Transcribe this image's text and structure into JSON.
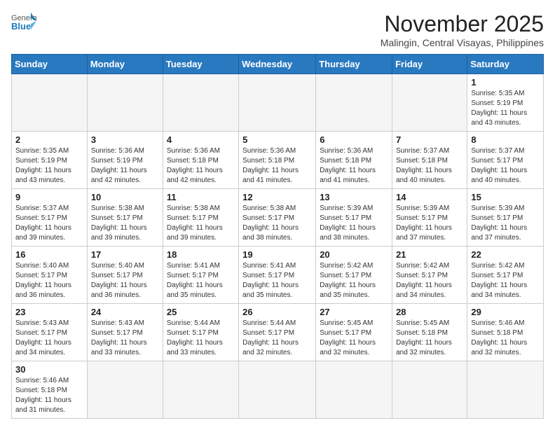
{
  "header": {
    "logo_general": "General",
    "logo_blue": "Blue",
    "month_title": "November 2025",
    "location": "Malingin, Central Visayas, Philippines"
  },
  "weekdays": [
    "Sunday",
    "Monday",
    "Tuesday",
    "Wednesday",
    "Thursday",
    "Friday",
    "Saturday"
  ],
  "weeks": [
    [
      {
        "day": null
      },
      {
        "day": null
      },
      {
        "day": null
      },
      {
        "day": null
      },
      {
        "day": null
      },
      {
        "day": null
      },
      {
        "day": 1,
        "sunrise": "Sunrise: 5:35 AM",
        "sunset": "Sunset: 5:19 PM",
        "daylight": "Daylight: 11 hours and 43 minutes."
      }
    ],
    [
      {
        "day": 2,
        "sunrise": "Sunrise: 5:35 AM",
        "sunset": "Sunset: 5:19 PM",
        "daylight": "Daylight: 11 hours and 43 minutes."
      },
      {
        "day": 3,
        "sunrise": "Sunrise: 5:36 AM",
        "sunset": "Sunset: 5:19 PM",
        "daylight": "Daylight: 11 hours and 42 minutes."
      },
      {
        "day": 4,
        "sunrise": "Sunrise: 5:36 AM",
        "sunset": "Sunset: 5:18 PM",
        "daylight": "Daylight: 11 hours and 42 minutes."
      },
      {
        "day": 5,
        "sunrise": "Sunrise: 5:36 AM",
        "sunset": "Sunset: 5:18 PM",
        "daylight": "Daylight: 11 hours and 41 minutes."
      },
      {
        "day": 6,
        "sunrise": "Sunrise: 5:36 AM",
        "sunset": "Sunset: 5:18 PM",
        "daylight": "Daylight: 11 hours and 41 minutes."
      },
      {
        "day": 7,
        "sunrise": "Sunrise: 5:37 AM",
        "sunset": "Sunset: 5:18 PM",
        "daylight": "Daylight: 11 hours and 40 minutes."
      },
      {
        "day": 8,
        "sunrise": "Sunrise: 5:37 AM",
        "sunset": "Sunset: 5:17 PM",
        "daylight": "Daylight: 11 hours and 40 minutes."
      }
    ],
    [
      {
        "day": 9,
        "sunrise": "Sunrise: 5:37 AM",
        "sunset": "Sunset: 5:17 PM",
        "daylight": "Daylight: 11 hours and 39 minutes."
      },
      {
        "day": 10,
        "sunrise": "Sunrise: 5:38 AM",
        "sunset": "Sunset: 5:17 PM",
        "daylight": "Daylight: 11 hours and 39 minutes."
      },
      {
        "day": 11,
        "sunrise": "Sunrise: 5:38 AM",
        "sunset": "Sunset: 5:17 PM",
        "daylight": "Daylight: 11 hours and 39 minutes."
      },
      {
        "day": 12,
        "sunrise": "Sunrise: 5:38 AM",
        "sunset": "Sunset: 5:17 PM",
        "daylight": "Daylight: 11 hours and 38 minutes."
      },
      {
        "day": 13,
        "sunrise": "Sunrise: 5:39 AM",
        "sunset": "Sunset: 5:17 PM",
        "daylight": "Daylight: 11 hours and 38 minutes."
      },
      {
        "day": 14,
        "sunrise": "Sunrise: 5:39 AM",
        "sunset": "Sunset: 5:17 PM",
        "daylight": "Daylight: 11 hours and 37 minutes."
      },
      {
        "day": 15,
        "sunrise": "Sunrise: 5:39 AM",
        "sunset": "Sunset: 5:17 PM",
        "daylight": "Daylight: 11 hours and 37 minutes."
      }
    ],
    [
      {
        "day": 16,
        "sunrise": "Sunrise: 5:40 AM",
        "sunset": "Sunset: 5:17 PM",
        "daylight": "Daylight: 11 hours and 36 minutes."
      },
      {
        "day": 17,
        "sunrise": "Sunrise: 5:40 AM",
        "sunset": "Sunset: 5:17 PM",
        "daylight": "Daylight: 11 hours and 36 minutes."
      },
      {
        "day": 18,
        "sunrise": "Sunrise: 5:41 AM",
        "sunset": "Sunset: 5:17 PM",
        "daylight": "Daylight: 11 hours and 35 minutes."
      },
      {
        "day": 19,
        "sunrise": "Sunrise: 5:41 AM",
        "sunset": "Sunset: 5:17 PM",
        "daylight": "Daylight: 11 hours and 35 minutes."
      },
      {
        "day": 20,
        "sunrise": "Sunrise: 5:42 AM",
        "sunset": "Sunset: 5:17 PM",
        "daylight": "Daylight: 11 hours and 35 minutes."
      },
      {
        "day": 21,
        "sunrise": "Sunrise: 5:42 AM",
        "sunset": "Sunset: 5:17 PM",
        "daylight": "Daylight: 11 hours and 34 minutes."
      },
      {
        "day": 22,
        "sunrise": "Sunrise: 5:42 AM",
        "sunset": "Sunset: 5:17 PM",
        "daylight": "Daylight: 11 hours and 34 minutes."
      }
    ],
    [
      {
        "day": 23,
        "sunrise": "Sunrise: 5:43 AM",
        "sunset": "Sunset: 5:17 PM",
        "daylight": "Daylight: 11 hours and 34 minutes."
      },
      {
        "day": 24,
        "sunrise": "Sunrise: 5:43 AM",
        "sunset": "Sunset: 5:17 PM",
        "daylight": "Daylight: 11 hours and 33 minutes."
      },
      {
        "day": 25,
        "sunrise": "Sunrise: 5:44 AM",
        "sunset": "Sunset: 5:17 PM",
        "daylight": "Daylight: 11 hours and 33 minutes."
      },
      {
        "day": 26,
        "sunrise": "Sunrise: 5:44 AM",
        "sunset": "Sunset: 5:17 PM",
        "daylight": "Daylight: 11 hours and 32 minutes."
      },
      {
        "day": 27,
        "sunrise": "Sunrise: 5:45 AM",
        "sunset": "Sunset: 5:17 PM",
        "daylight": "Daylight: 11 hours and 32 minutes."
      },
      {
        "day": 28,
        "sunrise": "Sunrise: 5:45 AM",
        "sunset": "Sunset: 5:18 PM",
        "daylight": "Daylight: 11 hours and 32 minutes."
      },
      {
        "day": 29,
        "sunrise": "Sunrise: 5:46 AM",
        "sunset": "Sunset: 5:18 PM",
        "daylight": "Daylight: 11 hours and 32 minutes."
      }
    ],
    [
      {
        "day": 30,
        "sunrise": "Sunrise: 5:46 AM",
        "sunset": "Sunset: 5:18 PM",
        "daylight": "Daylight: 11 hours and 31 minutes."
      },
      {
        "day": null
      },
      {
        "day": null
      },
      {
        "day": null
      },
      {
        "day": null
      },
      {
        "day": null
      },
      {
        "day": null
      }
    ]
  ]
}
